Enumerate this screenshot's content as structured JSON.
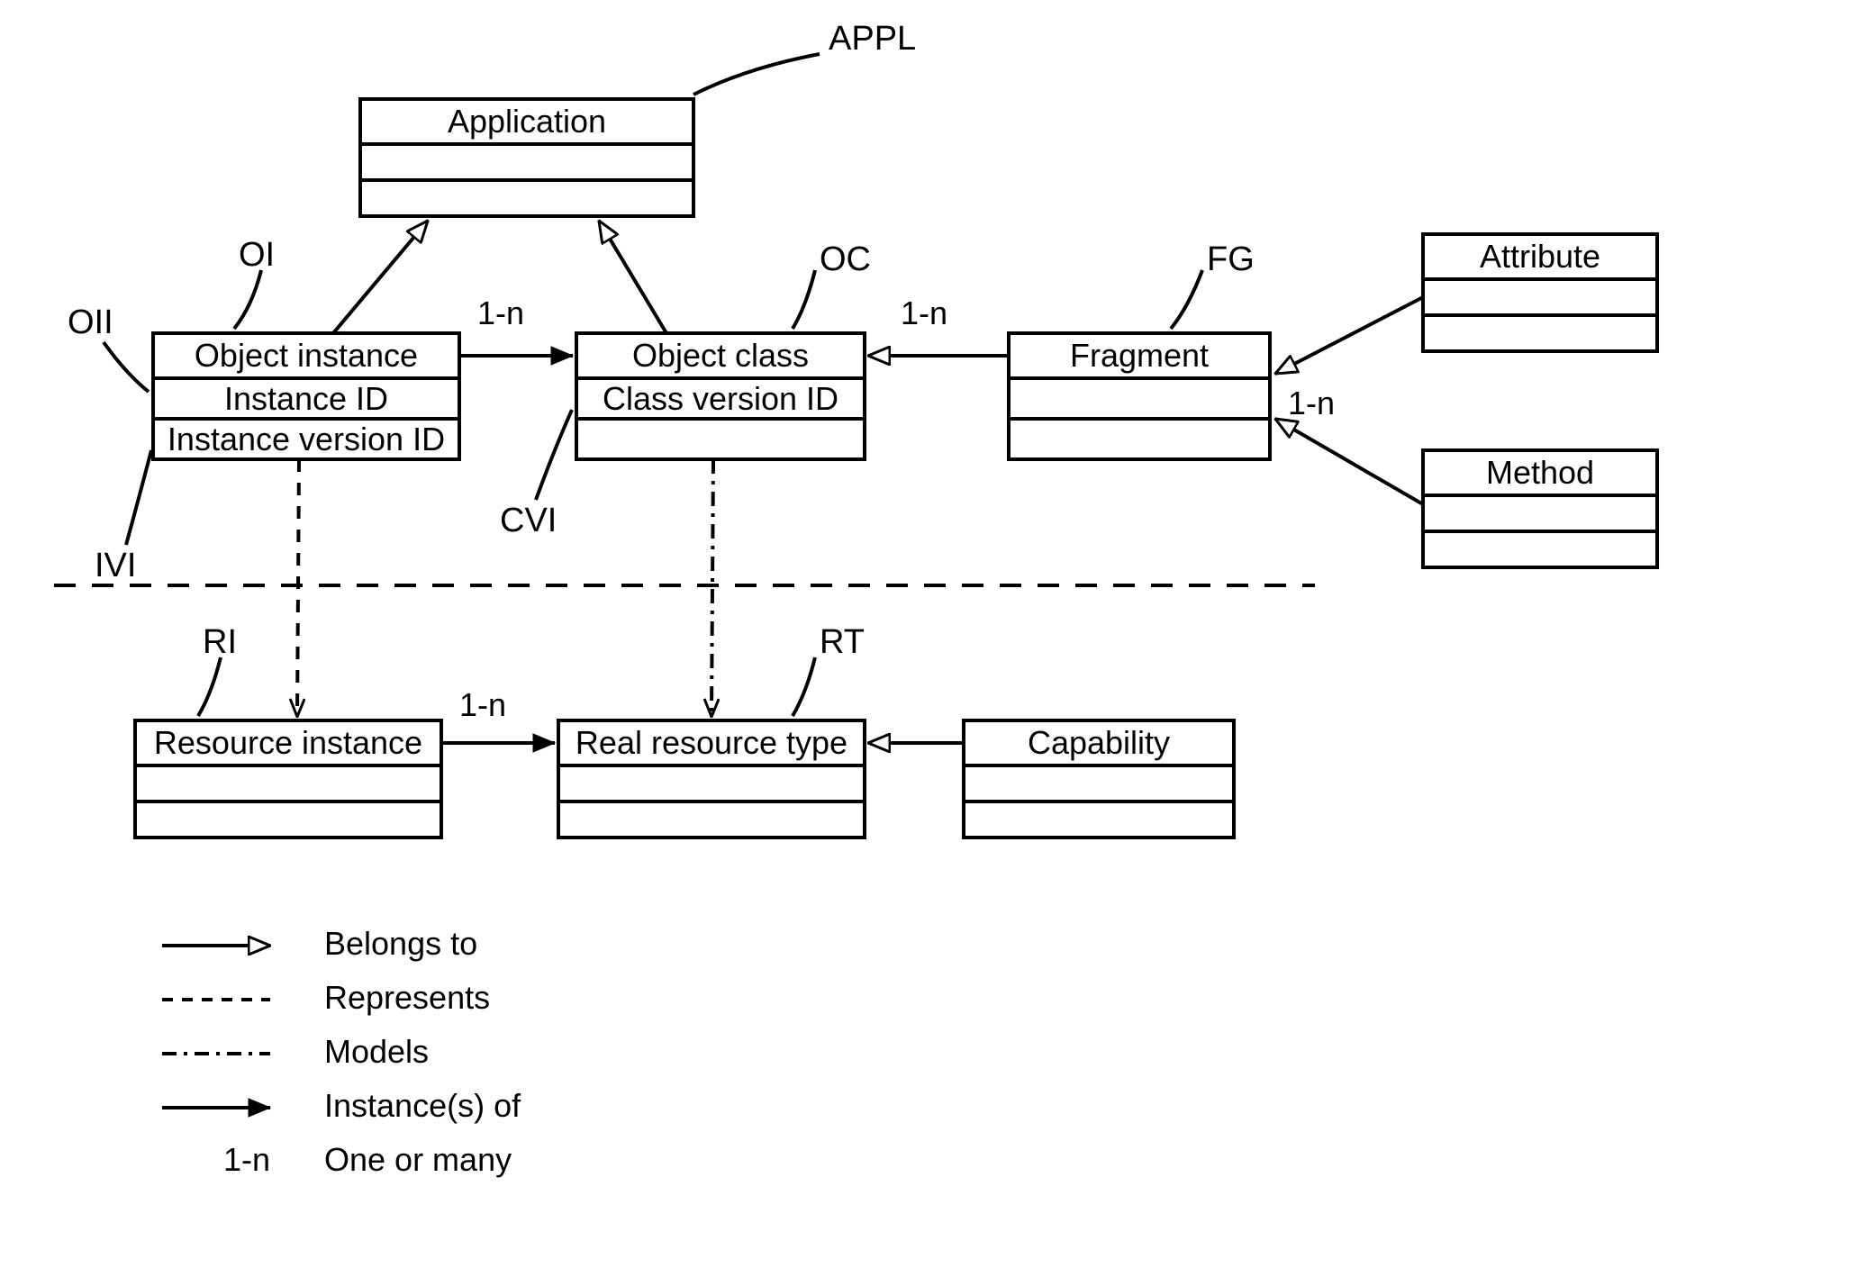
{
  "boxes": {
    "application": {
      "title": "Application",
      "attrs": []
    },
    "object_instance": {
      "title": "Object instance",
      "attrs": [
        "Instance ID",
        "Instance version ID"
      ]
    },
    "object_class": {
      "title": "Object class",
      "attrs": [
        "Class version ID"
      ]
    },
    "fragment": {
      "title": "Fragment",
      "attrs": []
    },
    "attribute": {
      "title": "Attribute",
      "attrs": []
    },
    "method": {
      "title": "Method",
      "attrs": []
    },
    "resource_instance": {
      "title": "Resource instance",
      "attrs": []
    },
    "real_resource_type": {
      "title": "Real resource type",
      "attrs": []
    },
    "capability": {
      "title": "Capability",
      "attrs": []
    }
  },
  "callouts": {
    "appl": "APPL",
    "oi": "OI",
    "oii": "OII",
    "ivi": "IVI",
    "oc": "OC",
    "cvi": "CVI",
    "fg": "FG",
    "ri": "RI",
    "rt": "RT"
  },
  "multiplicity": {
    "oi_oc": "1-n",
    "oc_fg": "1-n",
    "fg_attr": "1-n",
    "ri_rt": "1-n"
  },
  "legend": {
    "belongs_to": "Belongs to",
    "represents": "Represents",
    "models": "Models",
    "instances_of": "Instance(s) of",
    "one_or_many_key": "1-n",
    "one_or_many": "One or many"
  }
}
